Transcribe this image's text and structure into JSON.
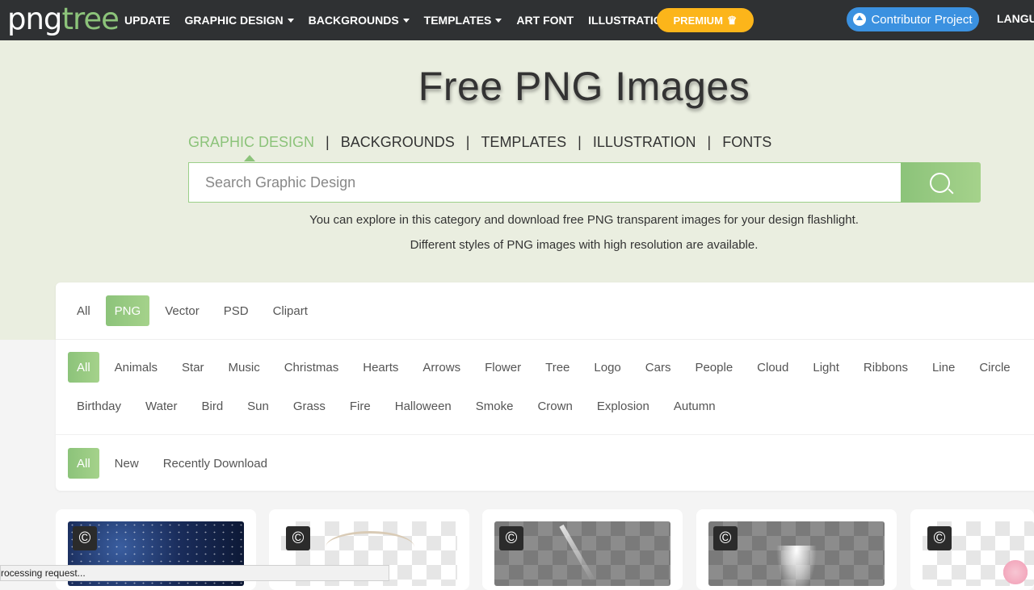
{
  "brand": {
    "png": "png",
    "tree": "tree"
  },
  "nav": {
    "items": [
      {
        "label": "UPDATE",
        "caret": false
      },
      {
        "label": "GRAPHIC DESIGN",
        "caret": true
      },
      {
        "label": "BACKGROUNDS",
        "caret": true
      },
      {
        "label": "TEMPLATES",
        "caret": true
      },
      {
        "label": "ART FONT",
        "caret": false
      },
      {
        "label": "ILLUSTRATION",
        "caret": false
      }
    ],
    "premium_label": "PREMIUM",
    "contributor_label": "Contributor Project",
    "language_label": "LANGU"
  },
  "hero": {
    "title": "Free PNG Images",
    "tabs": [
      "GRAPHIC DESIGN",
      "BACKGROUNDS",
      "TEMPLATES",
      "ILLUSTRATION",
      "FONTS"
    ],
    "active_tab": "GRAPHIC DESIGN",
    "search_placeholder": "Search Graphic Design",
    "desc_line1": "You can explore in this category and download free PNG transparent images for your design flashlight.",
    "desc_line2": "Different styles of PNG images with high resolution are available."
  },
  "filters": {
    "types": [
      "All",
      "PNG",
      "Vector",
      "PSD",
      "Clipart"
    ],
    "active_type": "PNG",
    "tags": [
      "All",
      "Animals",
      "Star",
      "Music",
      "Christmas",
      "Hearts",
      "Arrows",
      "Flower",
      "Tree",
      "Logo",
      "Cars",
      "People",
      "Cloud",
      "Light",
      "Ribbons",
      "Line",
      "Circle",
      "Birthday",
      "Water",
      "Bird",
      "Sun",
      "Grass",
      "Fire",
      "Halloween",
      "Smoke",
      "Crown",
      "Explosion",
      "Autumn"
    ],
    "active_tag": "All",
    "sort": [
      "All",
      "New",
      "Recently Download"
    ],
    "active_sort": "All"
  },
  "cards": [
    {
      "thumb": "starry-sky",
      "badge": "©"
    },
    {
      "thumb": "ornament",
      "badge": "©"
    },
    {
      "thumb": "sparkle-trail",
      "badge": "©"
    },
    {
      "thumb": "spotlight",
      "badge": "©"
    },
    {
      "thumb": "flowers",
      "badge": "©"
    }
  ],
  "status_bar": "rocessing request...",
  "colors": {
    "accent_green": "#8cc37a",
    "nav_bg": "#2f3133",
    "premium": "#fcb51a",
    "contributor": "#3b91e0",
    "hero_bg": "#eaeee0"
  }
}
